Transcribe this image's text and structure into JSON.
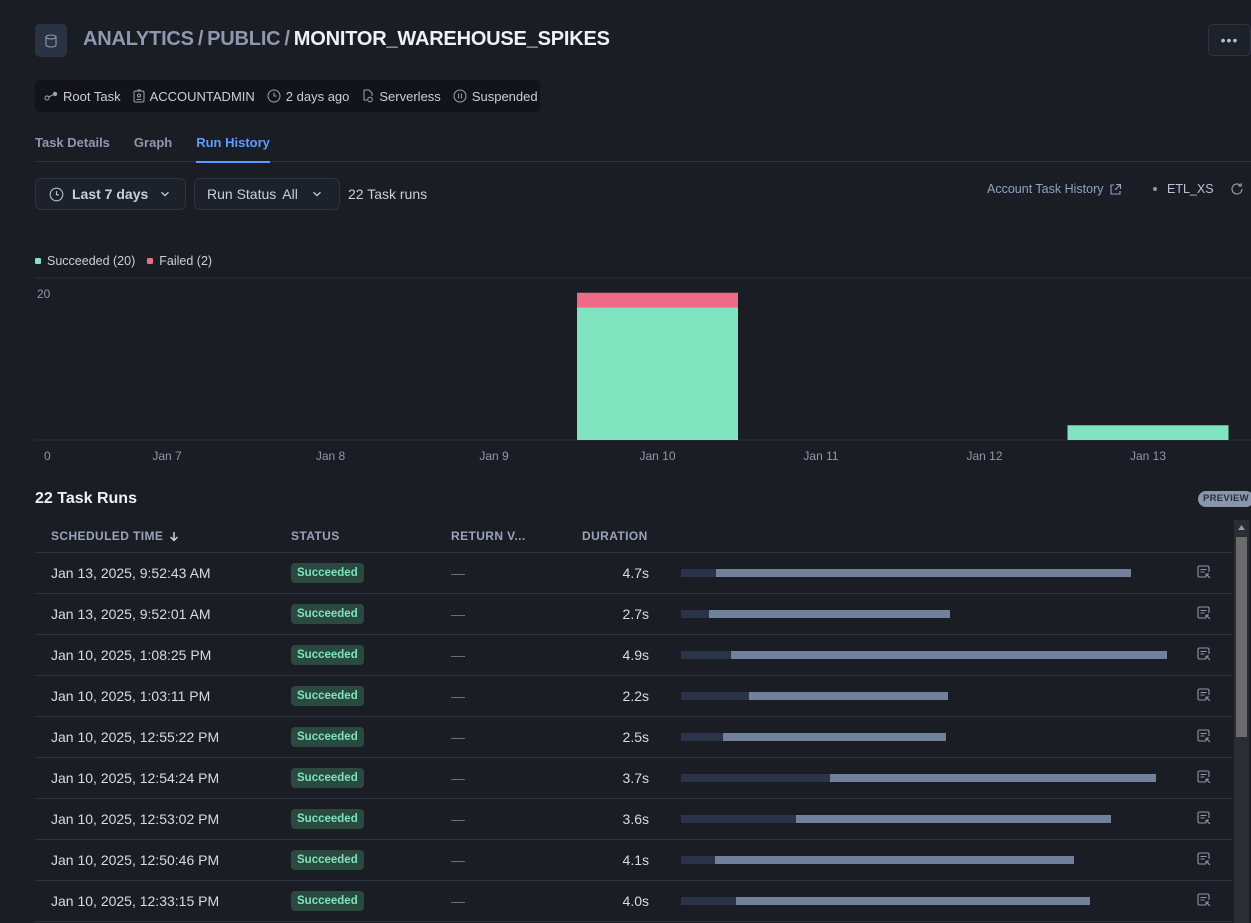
{
  "header": {
    "object_icon": "database-icon",
    "breadcrumb": [
      "ANALYTICS",
      "PUBLIC"
    ],
    "title": "MONITOR_WAREHOUSE_SPIKES",
    "more_label": "•••"
  },
  "meta": {
    "task_type": "Root Task",
    "owner": "ACCOUNTADMIN",
    "modified": "2 days ago",
    "warehouse_type": "Serverless",
    "state": "Suspended"
  },
  "tabs": [
    {
      "label": "Task Details",
      "active": false
    },
    {
      "label": "Graph",
      "active": false
    },
    {
      "label": "Run History",
      "active": true
    }
  ],
  "filters": {
    "date_range": "Last 7 days",
    "run_status_label": "Run Status",
    "run_status_value": "All",
    "runs_count": "22 Task runs",
    "account_history_link": "Account Task History",
    "warehouse": "ETL_XS"
  },
  "colors": {
    "succeeded": "#7fe3c0",
    "failed": "#f06a87",
    "accent": "#5b9cff"
  },
  "chart_data": {
    "type": "bar",
    "stacked": true,
    "categories": [
      "Jan 7",
      "Jan 8",
      "Jan 9",
      "Jan 10",
      "Jan 11",
      "Jan 12",
      "Jan 13"
    ],
    "series": [
      {
        "name": "Succeeded",
        "legend": "Succeeded (20)",
        "values": [
          0,
          0,
          0,
          18,
          0,
          0,
          2
        ]
      },
      {
        "name": "Failed",
        "legend": "Failed (2)",
        "values": [
          0,
          0,
          0,
          2,
          0,
          0,
          0
        ]
      }
    ],
    "y_ticks": [
      "0",
      "20"
    ],
    "ylim": [
      0,
      22
    ],
    "legend_position": "top-left",
    "grid": true
  },
  "table": {
    "title": "22 Task Runs",
    "badge": "PREVIEW",
    "columns": [
      "SCHEDULED TIME",
      "STATUS",
      "RETURN V...",
      "DURATION"
    ],
    "sort_column": "SCHEDULED TIME",
    "sort_direction": "desc",
    "rows": [
      {
        "time": "Jan 13, 2025, 9:52:43 AM",
        "status": "Succeeded",
        "return": "—",
        "duration": "4.7s",
        "queue_frac": 0.072,
        "end_frac": 0.918
      },
      {
        "time": "Jan 13, 2025, 9:52:01 AM",
        "status": "Succeeded",
        "return": "—",
        "duration": "2.7s",
        "queue_frac": 0.057,
        "end_frac": 0.549
      },
      {
        "time": "Jan 10, 2025, 1:08:25 PM",
        "status": "Succeeded",
        "return": "—",
        "duration": "4.9s",
        "queue_frac": 0.102,
        "end_frac": 0.992
      },
      {
        "time": "Jan 10, 2025, 1:03:11 PM",
        "status": "Succeeded",
        "return": "—",
        "duration": "2.2s",
        "queue_frac": 0.139,
        "end_frac": 0.545
      },
      {
        "time": "Jan 10, 2025, 12:55:22 PM",
        "status": "Succeeded",
        "return": "—",
        "duration": "2.5s",
        "queue_frac": 0.086,
        "end_frac": 0.54
      },
      {
        "time": "Jan 10, 2025, 12:54:24 PM",
        "status": "Succeeded",
        "return": "—",
        "duration": "3.7s",
        "queue_frac": 0.304,
        "end_frac": 0.969
      },
      {
        "time": "Jan 10, 2025, 12:53:02 PM",
        "status": "Succeeded",
        "return": "—",
        "duration": "3.6s",
        "queue_frac": 0.235,
        "end_frac": 0.878
      },
      {
        "time": "Jan 10, 2025, 12:50:46 PM",
        "status": "Succeeded",
        "return": "—",
        "duration": "4.1s",
        "queue_frac": 0.069,
        "end_frac": 0.802
      },
      {
        "time": "Jan 10, 2025, 12:33:15 PM",
        "status": "Succeeded",
        "return": "—",
        "duration": "4.0s",
        "queue_frac": 0.112,
        "end_frac": 0.835
      }
    ]
  }
}
